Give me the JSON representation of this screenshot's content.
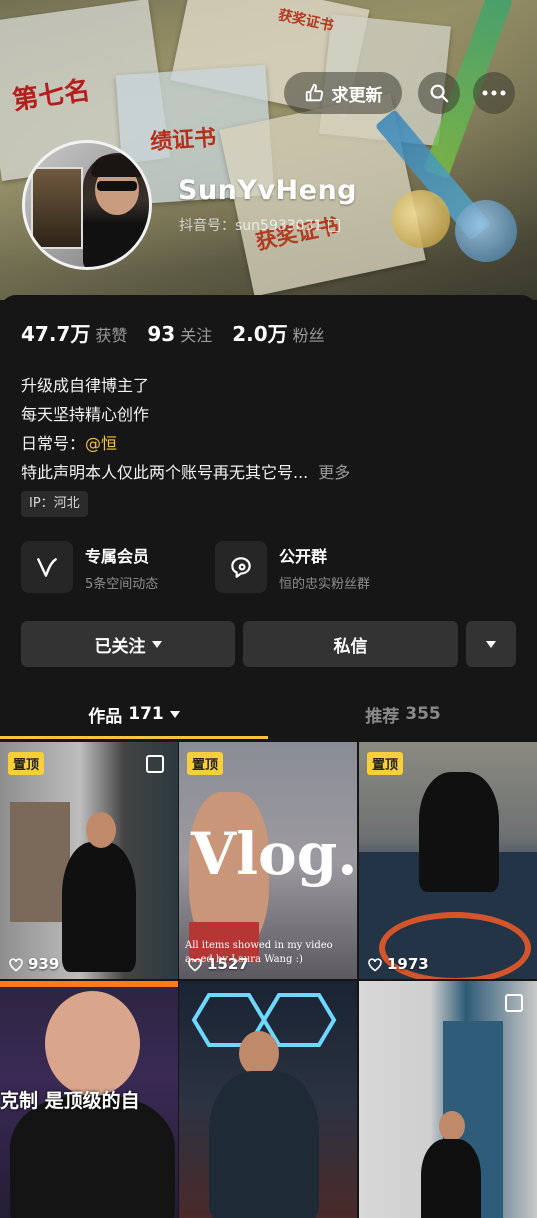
{
  "header": {
    "update_label": "求更新",
    "cert_texts": [
      "第七名",
      "绩证书",
      "获奖证书",
      "获奖证书"
    ]
  },
  "profile": {
    "nickname": "SunYvHeng",
    "account_id": "抖音号：sun5933031"
  },
  "stats": [
    {
      "value": "47.7万",
      "label": "获赞"
    },
    {
      "value": "93",
      "label": "关注"
    },
    {
      "value": "2.0万",
      "label": "粉丝"
    }
  ],
  "bio": {
    "line1": "升级成自律博主了",
    "line2": "每天坚持精心创作",
    "line3_prefix": "日常号：",
    "line3_mention": "@恒",
    "line4": "特此声明本人仅此两个账号再无其它号...",
    "more": "更多"
  },
  "ip": "IP：河北",
  "features": [
    {
      "title": "专属会员",
      "sub": "5条空间动态",
      "icon": "vip-v-icon"
    },
    {
      "title": "公开群",
      "sub": "恒的忠实粉丝群",
      "icon": "group-chat-icon"
    }
  ],
  "actions": {
    "follow": "已关注",
    "message": "私信"
  },
  "tabs": [
    {
      "label": "作品",
      "count": "171"
    },
    {
      "label": "推荐",
      "count": "355"
    }
  ],
  "videos": [
    {
      "likes": "939",
      "pinned": true,
      "pin_label": "置顶",
      "multi": true
    },
    {
      "likes": "1527",
      "pinned": true,
      "pin_label": "置顶",
      "overlay_title": "Vlog.",
      "overlay_caption": "All items showed in my video",
      "overlay_caption2": "a...ed by Laura Wang :)"
    },
    {
      "likes": "1973",
      "pinned": true,
      "pin_label": "置顶"
    },
    {
      "likes": "",
      "overlay_text": "克制 是顶级的自"
    },
    {
      "likes": ""
    },
    {
      "likes": "",
      "multi": true
    }
  ],
  "colors": {
    "accent": "#f5c341",
    "background": "#161616",
    "button": "#333333"
  }
}
